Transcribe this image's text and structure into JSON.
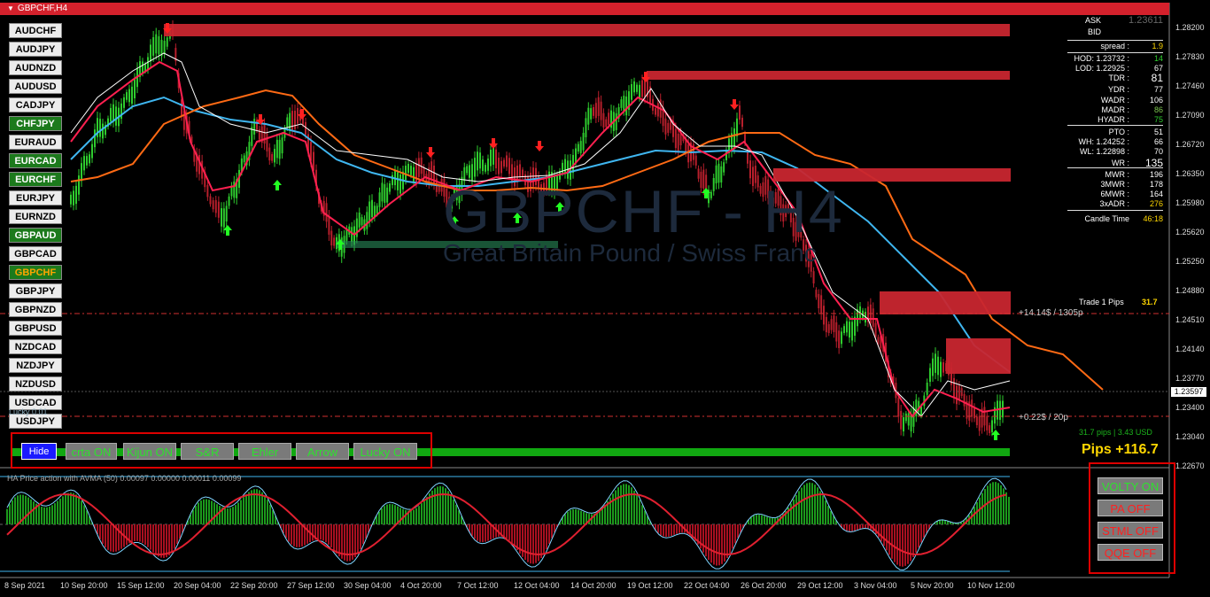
{
  "window": {
    "title": "GBPCHF,H4"
  },
  "watermark": {
    "symbol": "GBPCHF - H4",
    "description": "Great Britain Pound / Swiss Franc"
  },
  "symbols": [
    {
      "label": "AUDCHF",
      "state": "white"
    },
    {
      "label": "AUDJPY",
      "state": "white"
    },
    {
      "label": "AUDNZD",
      "state": "white"
    },
    {
      "label": "AUDUSD",
      "state": "white"
    },
    {
      "label": "CADJPY",
      "state": "white"
    },
    {
      "label": "CHFJPY",
      "state": "green"
    },
    {
      "label": "EURAUD",
      "state": "white"
    },
    {
      "label": "EURCAD",
      "state": "green"
    },
    {
      "label": "EURCHF",
      "state": "green"
    },
    {
      "label": "EURJPY",
      "state": "white"
    },
    {
      "label": "EURNZD",
      "state": "white"
    },
    {
      "label": "GBPAUD",
      "state": "green"
    },
    {
      "label": "GBPCAD",
      "state": "white"
    },
    {
      "label": "GBPCHF",
      "state": "orange"
    },
    {
      "label": "GBPJPY",
      "state": "white"
    },
    {
      "label": "GBPNZD",
      "state": "white"
    },
    {
      "label": "GBPUSD",
      "state": "white"
    },
    {
      "label": "NZDCAD",
      "state": "white"
    },
    {
      "label": "NZDJPY",
      "state": "white"
    },
    {
      "label": "NZDUSD",
      "state": "white"
    },
    {
      "label": "USDCAD",
      "state": "white"
    },
    {
      "label": "USDJPY",
      "state": "white"
    }
  ],
  "toolbar": {
    "hide": "Hide",
    "buttons": [
      "crta ON",
      "Kijun ON",
      "S&R",
      "Ehler",
      "Arrow",
      "Lucky ON"
    ]
  },
  "indicator_buttons": [
    {
      "label": "VOLTY ON",
      "color": "#2ee12e"
    },
    {
      "label": "PA OFF",
      "color": "#ff2020"
    },
    {
      "label": "STML OFF",
      "color": "#ff2020"
    },
    {
      "label": "QQE OFF",
      "color": "#ff2020"
    }
  ],
  "info_panel": {
    "ask_label": "ASK",
    "ask": "1.23611",
    "bid_label": "BID",
    "spread_label": "spread :",
    "spread": "1.9",
    "rows": [
      {
        "label": "HOD: 1.23732 :",
        "value": "14"
      },
      {
        "label": "LOD: 1.22925 :",
        "value": "67"
      },
      {
        "label": "TDR :",
        "value": "81"
      },
      {
        "label": "YDR :",
        "value": "77"
      },
      {
        "label": "WADR :",
        "value": "106"
      },
      {
        "label": "MADR :",
        "value": "86"
      },
      {
        "label": "HYADR :",
        "value": "75"
      },
      {
        "label": "PTO :",
        "value": "51"
      },
      {
        "label": "WH: 1.24252 :",
        "value": "66"
      },
      {
        "label": "WL: 1.22898 :",
        "value": "70"
      },
      {
        "label": "WR :",
        "value": "135"
      },
      {
        "label": "MWR :",
        "value": "196"
      },
      {
        "label": "3MWR :",
        "value": "178"
      },
      {
        "label": "6MWR :",
        "value": "164"
      },
      {
        "label": "3xADR :",
        "value": "276"
      }
    ],
    "candle_label": "Candle Time",
    "candle_time": "46:18"
  },
  "trade": {
    "label": "Trade 1 Pips",
    "pips": "31.7",
    "line1": "+14.14$ / 1305p",
    "line2": "+0.22$ / 20p",
    "summary": "31.7 pips | 3.43 USD",
    "total": "Pips +116.7"
  },
  "current_price": "1.23597",
  "price_axis": [
    "1.28200",
    "1.27830",
    "1.27460",
    "1.27090",
    "1.26720",
    "1.26350",
    "1.25980",
    "1.25620",
    "1.25250",
    "1.24880",
    "1.24510",
    "1.24140",
    "1.23770",
    "1.23400",
    "1.23040",
    "1.22670"
  ],
  "time_axis": [
    "8 Sep 2021",
    "10 Sep 20:00",
    "15 Sep 12:00",
    "20 Sep 04:00",
    "22 Sep 20:00",
    "27 Sep 12:00",
    "30 Sep 04:00",
    "4 Oct 20:00",
    "7 Oct 12:00",
    "12 Oct 04:00",
    "14 Oct 20:00",
    "19 Oct 12:00",
    "22 Oct 04:00",
    "26 Oct 20:00",
    "29 Oct 12:00",
    "3 Nov 04:00",
    "5 Nov 20:00",
    "10 Nov 12:00"
  ],
  "sub_window": {
    "title": "HA Price action with AVMA (50) 0.00097 0.00000 0.00011 0.00099",
    "lucky_label": "Lucky 0.01"
  },
  "colors": {
    "bull": "#2ecc2e",
    "bear": "#e0203a",
    "zone": "#c8262f",
    "ma_blue": "#3fb6f0",
    "ma_orange": "#ff6a14"
  }
}
